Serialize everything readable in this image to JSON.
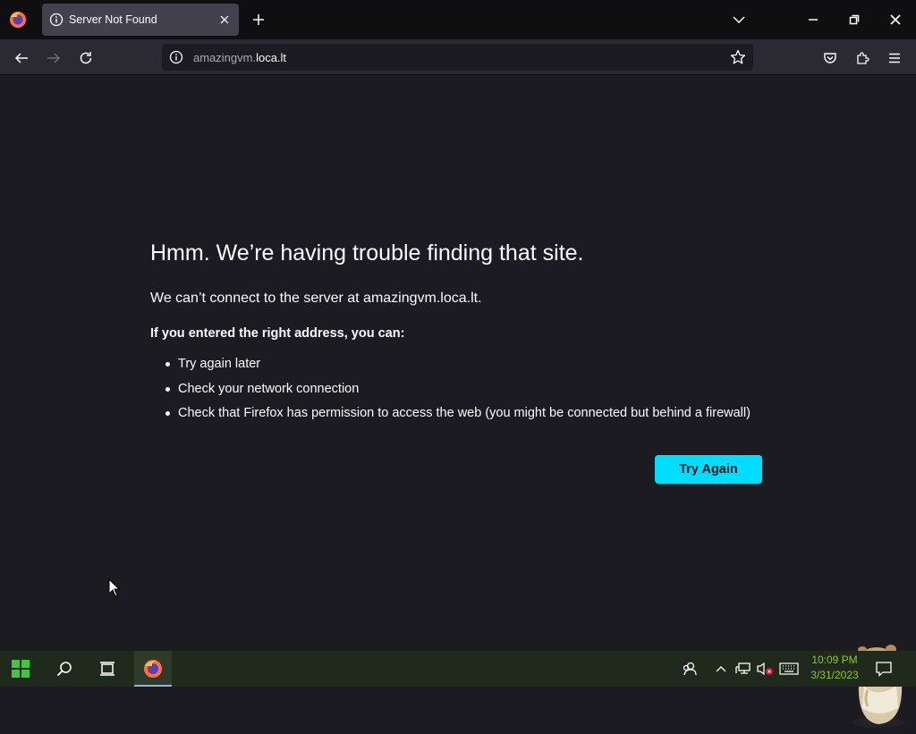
{
  "tab": {
    "title": "Server Not Found"
  },
  "urlbar": {
    "url_prefix": "amazingvm.",
    "url_domain": "loca.lt"
  },
  "error": {
    "title": "Hmm. We’re having trouble finding that site.",
    "description": "We can’t connect to the server at amazingvm.loca.lt.",
    "subheading": "If you entered the right address, you can:",
    "items": [
      "Try again later",
      "Check your network connection",
      "Check that Firefox has permission to access the web (you might be connected but behind a firewall)"
    ],
    "button_label": "Try Again"
  },
  "taskbar": {
    "time": "10:09 PM",
    "date": "3/31/2023"
  },
  "colors": {
    "accent": "#00ddff",
    "page_bg": "#1c1b22",
    "clock": "#8ac926"
  },
  "icons": [
    "firefox-icon",
    "info-icon",
    "close-icon",
    "plus-icon",
    "chevron-down-icon",
    "minimize-icon",
    "restore-icon",
    "back-icon",
    "forward-icon",
    "reload-icon",
    "star-icon",
    "pocket-icon",
    "extensions-icon",
    "menu-icon",
    "windows-start-icon",
    "search-icon",
    "task-view-icon",
    "people-icon",
    "tray-chevron-icon",
    "network-icon",
    "volume-muted-icon",
    "keyboard-icon",
    "notification-icon"
  ]
}
